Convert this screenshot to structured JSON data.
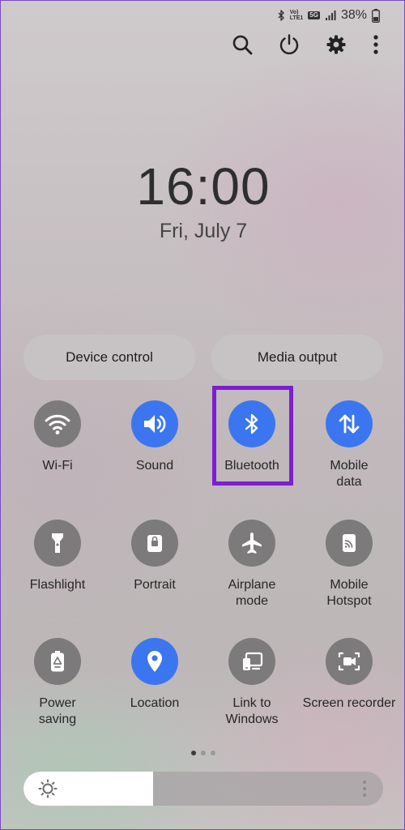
{
  "status_bar": {
    "network_label_top": "Vo)",
    "network_label_mid": "LTE1",
    "network_type": "5G",
    "battery_percent": "38%",
    "icons": [
      "bluetooth-icon",
      "signal-icon",
      "battery-icon"
    ]
  },
  "header": {
    "icons": [
      "search-icon",
      "power-icon",
      "settings-icon",
      "more-vert-icon"
    ]
  },
  "clock": {
    "time": "16:00",
    "date": "Fri, July 7"
  },
  "buttons": {
    "device_control": "Device control",
    "media_output": "Media output"
  },
  "tiles": [
    {
      "label": "Wi-Fi",
      "icon": "wifi-icon",
      "state": "off"
    },
    {
      "label": "Sound",
      "icon": "sound-icon",
      "state": "on"
    },
    {
      "label": "Bluetooth",
      "icon": "bluetooth-icon",
      "state": "on",
      "highlighted": true
    },
    {
      "label": "Mobile\ndata",
      "icon": "mobile-data-icon",
      "state": "on"
    },
    {
      "label": "Flashlight",
      "icon": "flashlight-icon",
      "state": "off"
    },
    {
      "label": "Portrait",
      "icon": "portrait-icon",
      "state": "off"
    },
    {
      "label": "Airplane\nmode",
      "icon": "airplane-icon",
      "state": "off"
    },
    {
      "label": "Mobile\nHotspot",
      "icon": "hotspot-icon",
      "state": "off"
    },
    {
      "label": "Power\nsaving",
      "icon": "power-saving-icon",
      "state": "off"
    },
    {
      "label": "Location",
      "icon": "location-icon",
      "state": "on"
    },
    {
      "label": "Link to\nWindows",
      "icon": "link-to-windows-icon",
      "state": "off"
    },
    {
      "label": "Screen recorder",
      "icon": "screen-recorder-icon",
      "state": "off"
    }
  ],
  "pagination": {
    "pages": 3,
    "current": 1
  },
  "brightness": {
    "level": 0.36
  },
  "colors": {
    "accent": "#3b76f0",
    "tile_off": "#7c7a7b",
    "highlight": "#7b1fd2"
  }
}
